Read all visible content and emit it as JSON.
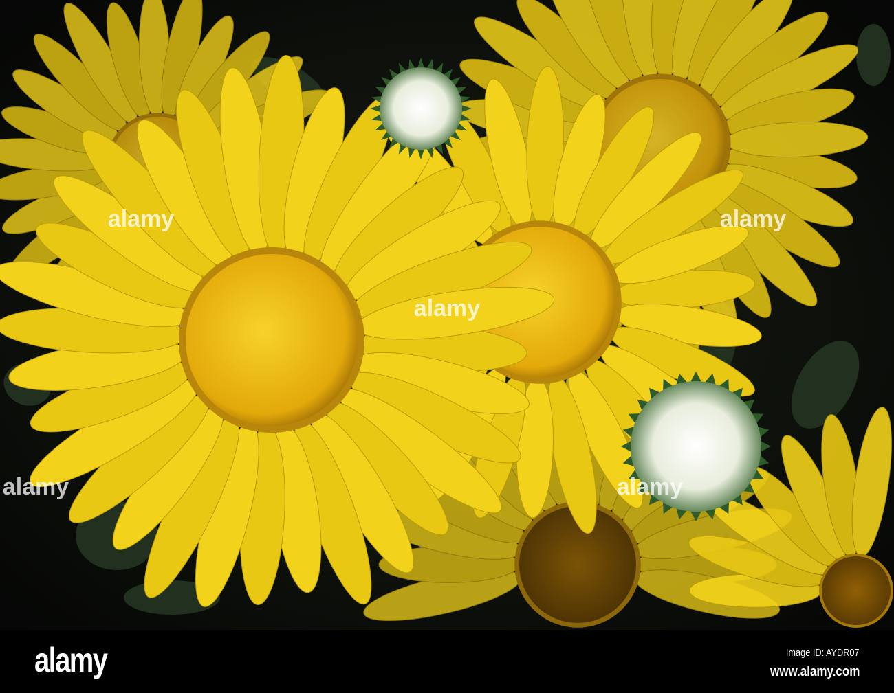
{
  "photo": {
    "subject": "yellow gumweed flowers",
    "colors": {
      "petal": "#f2d21a",
      "disc": "#e8b10c",
      "background": "#0b0f0a",
      "bud": "#eef2e6"
    }
  },
  "watermark": {
    "text": "alamy"
  },
  "footer": {
    "logo": "alamy",
    "image_id": "Image ID: AYDR07",
    "website": "www.alamy.com"
  }
}
